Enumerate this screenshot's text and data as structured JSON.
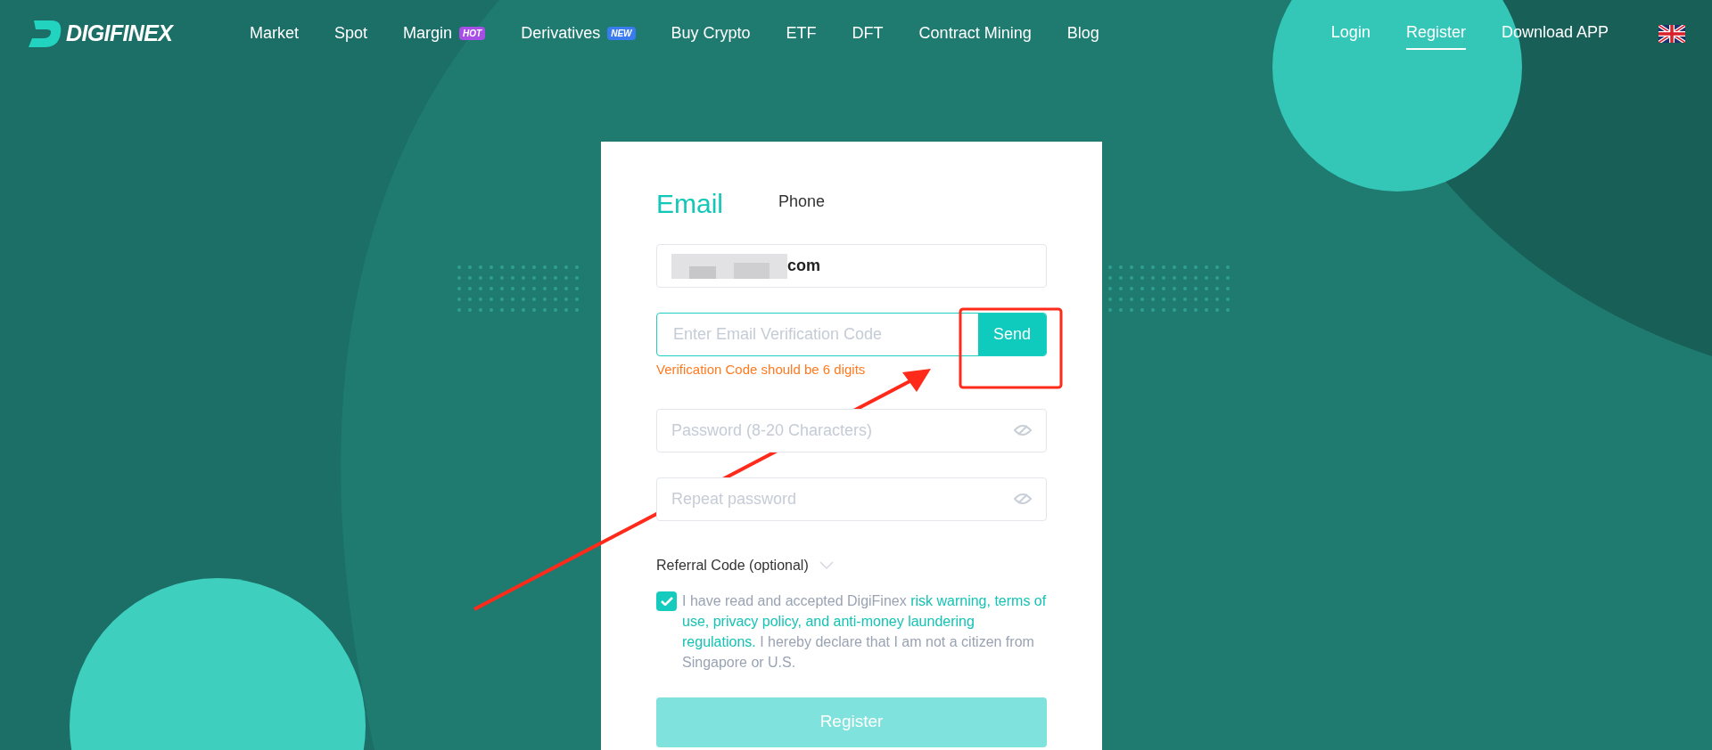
{
  "header": {
    "logo": "DIGIFINEX",
    "nav": [
      {
        "label": "Market"
      },
      {
        "label": "Spot"
      },
      {
        "label": "Margin",
        "badge": {
          "text": "HOT",
          "color": "#a64ee6"
        }
      },
      {
        "label": "Derivatives",
        "badge": {
          "text": "NEW",
          "color": "#3a7bf0"
        }
      },
      {
        "label": "Buy Crypto"
      },
      {
        "label": "ETF"
      },
      {
        "label": "DFT"
      },
      {
        "label": "Contract Mining"
      },
      {
        "label": "Blog"
      }
    ],
    "account": [
      {
        "label": "Login",
        "selected": false
      },
      {
        "label": "Register",
        "selected": true
      },
      {
        "label": "Download APP",
        "selected": false
      }
    ]
  },
  "form": {
    "tabs": [
      {
        "label": "Email",
        "selected": true
      },
      {
        "label": "Phone",
        "selected": false
      }
    ],
    "fields": [
      {
        "kind": "text",
        "value": "com",
        "redacted": true
      },
      {
        "kind": "code",
        "placeholder": "Enter Email Verification Code",
        "focused": true,
        "button": "Send",
        "error": "Verification Code should be 6 digits"
      },
      {
        "kind": "password",
        "placeholder": "Password (8-20 Characters)"
      },
      {
        "kind": "password",
        "placeholder": "Repeat password"
      }
    ],
    "referral": {
      "label": "Referral Code (optional)",
      "expanded": false
    },
    "consent": {
      "checked": true,
      "parts": [
        {
          "text": "I have read and accepted DigiFinex ",
          "link": false
        },
        {
          "text": "risk warning, terms of use, privacy policy, and anti-money laundering regulations.",
          "link": true
        },
        {
          "text": " I hereby declare that I am not a citizen from Singapore or U.S.",
          "link": false
        }
      ]
    },
    "submit": {
      "label": "Register",
      "disabled": true
    }
  }
}
